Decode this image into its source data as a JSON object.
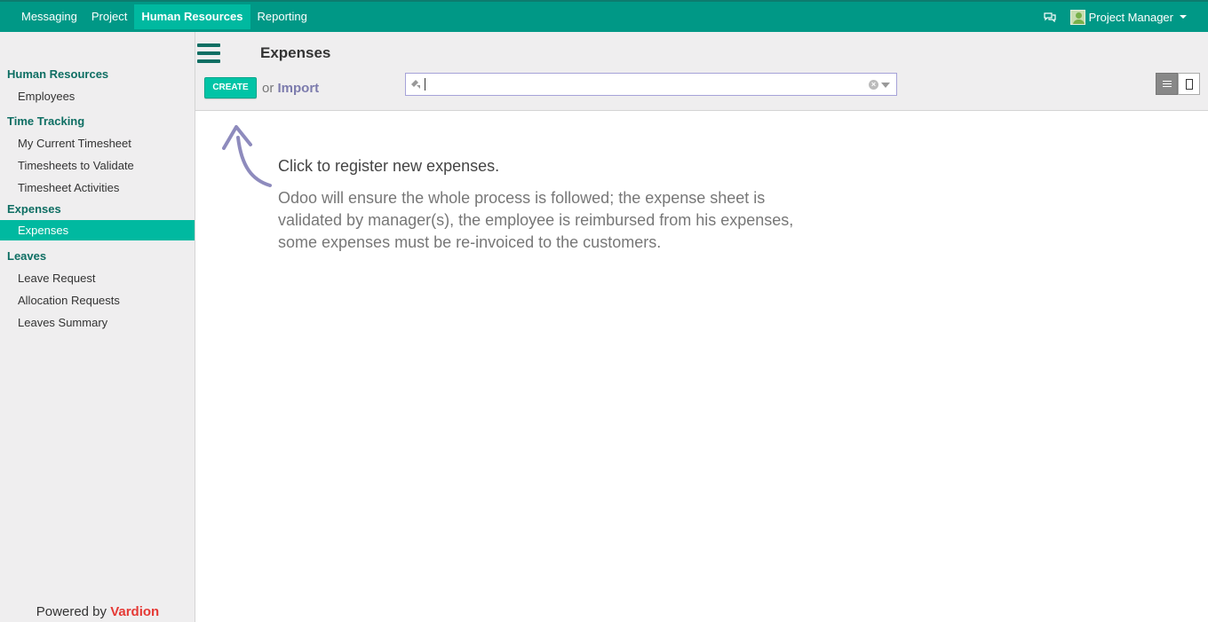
{
  "topnav": {
    "items": [
      "Messaging",
      "Project",
      "Human Resources",
      "Reporting"
    ],
    "active": "Human Resources"
  },
  "user": {
    "name": "Project Manager"
  },
  "sidebar": {
    "sections": [
      {
        "title": "Human Resources",
        "items": [
          "Employees"
        ]
      },
      {
        "title": "Time Tracking",
        "items": [
          "My Current Timesheet",
          "Timesheets to Validate",
          "Timesheet Activities"
        ]
      },
      {
        "title": "Expenses",
        "items": [
          "Expenses"
        ]
      },
      {
        "title": "Leaves",
        "items": [
          "Leave Request",
          "Allocation Requests",
          "Leaves Summary"
        ]
      }
    ],
    "active_item": "Expenses",
    "powered_by_prefix": "Powered by",
    "powered_by_brand": "Vardion"
  },
  "control": {
    "page_title": "Expenses",
    "create_label": "CREATE",
    "or_text": "or",
    "import_label": "Import",
    "search_value": ""
  },
  "help": {
    "title": "Click to register new expenses.",
    "body": "Odoo will ensure the whole process is followed; the expense sheet is validated by manager(s), the employee is reimbursed from his expenses, some expenses must be re-invoiced to the customers."
  },
  "colors": {
    "brand": "#009886",
    "accent": "#00b9a0",
    "create_button": "#00c4a6",
    "import_link": "#7c7bad",
    "powered_brand": "#e53935"
  },
  "icons": {
    "chat": "chat-icon",
    "menu": "hamburger-icon",
    "filter": "filter-icon",
    "clear": "clear-icon",
    "dropdown": "chevron-down-icon",
    "list_view": "list-view-icon",
    "form_view": "form-view-icon"
  }
}
